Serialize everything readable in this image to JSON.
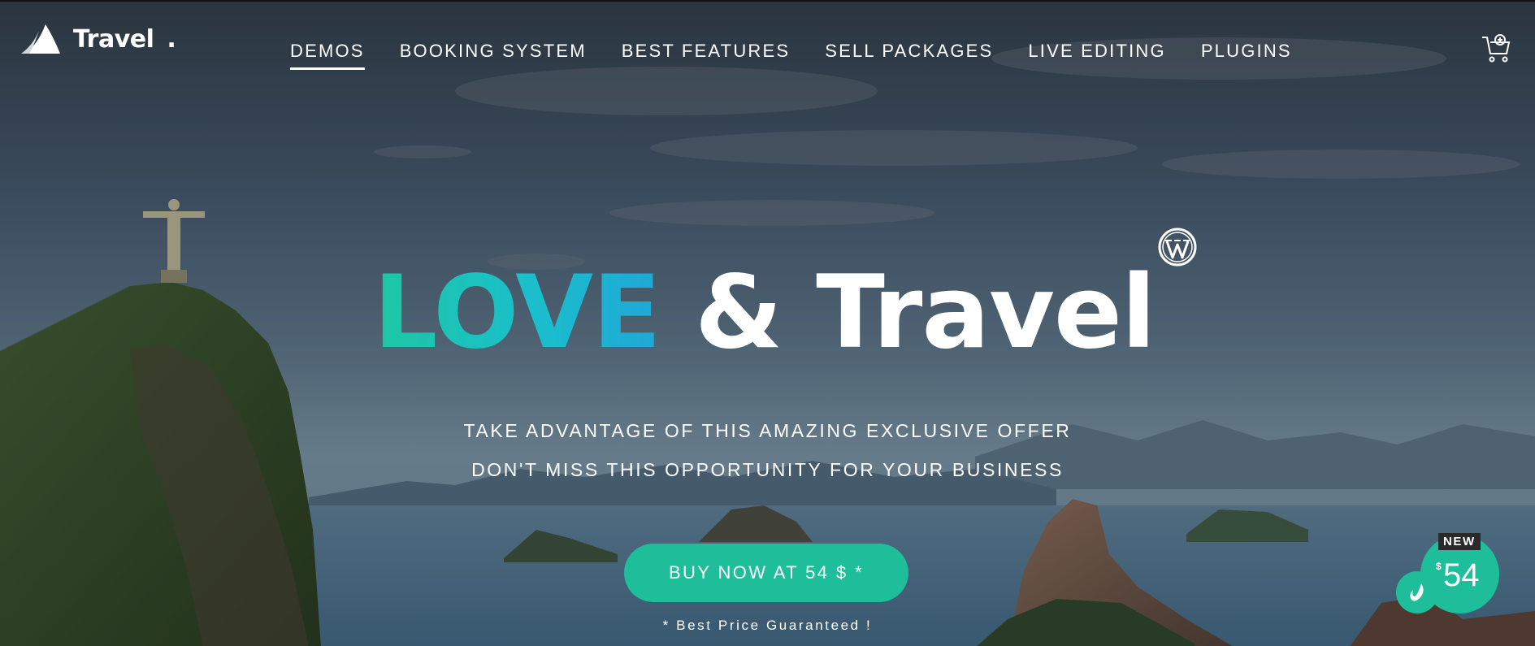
{
  "brand": {
    "name": "Travel",
    "dot": "."
  },
  "nav": {
    "items": [
      {
        "label": "DEMOS",
        "active": true
      },
      {
        "label": "BOOKING SYSTEM",
        "active": false
      },
      {
        "label": "BEST FEATURES",
        "active": false
      },
      {
        "label": "SELL PACKAGES",
        "active": false
      },
      {
        "label": "LIVE EDITING",
        "active": false
      },
      {
        "label": "PLUGINS",
        "active": false
      }
    ]
  },
  "hero": {
    "headline_accent": "LOVE",
    "headline_rest": " & Travel",
    "tagline_1": "TAKE ADVANTAGE OF THIS AMAZING EXCLUSIVE OFFER",
    "tagline_2": "DON'T MISS THIS OPPORTUNITY FOR YOUR BUSINESS",
    "cta_label": "BUY NOW AT 54 $ *",
    "guarantee": "* Best Price Guaranteed !"
  },
  "price_badge": {
    "tag": "NEW",
    "currency": "$",
    "amount": "54"
  },
  "icons": {
    "logo": "sail-logo-icon",
    "cart": "cart-icon",
    "wordpress": "wordpress-icon",
    "envato": "envato-leaf-icon"
  },
  "colors": {
    "accent": "#1fbe9a",
    "accent_gradient_end": "#1fa7d6",
    "text": "#ffffff"
  }
}
